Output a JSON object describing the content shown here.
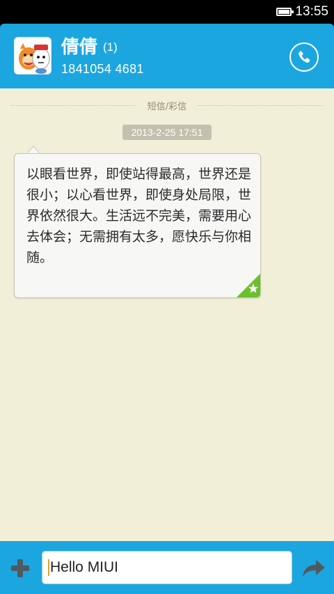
{
  "status_bar": {
    "time": "13:55",
    "battery_level": 1.0,
    "battery_icon": "battery-icon"
  },
  "header": {
    "contact_name": "倩倩",
    "unread_count": "(1)",
    "phone_number": "1841054 4681",
    "avatar_icon": "avatar-cartoon-icon",
    "call_icon": "phone-icon"
  },
  "conversation": {
    "divider_label": "短信/彩信",
    "timestamp": "2013-2-25 17:51",
    "message_text": "以眼看世界，即使站得最高，世界还是很小；以心看世界，即使身处局限，世界依然很大。生活远不完美，需要用心去体会；无需拥有太多，愿快乐与你相随。",
    "star_icon": "star-icon"
  },
  "composer": {
    "input_value": "Hello MIUI",
    "add_icon": "plus-icon",
    "send_icon": "send-arrow-icon"
  },
  "colors": {
    "accent": "#1ca6e0",
    "background": "#f2efd8",
    "bubble": "#f7f7f5",
    "star_green": "#6cbf2f"
  }
}
